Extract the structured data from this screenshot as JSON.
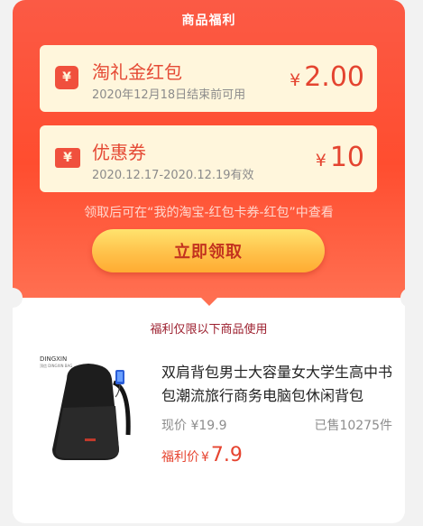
{
  "header": {
    "title": "商品福利"
  },
  "coupons": [
    {
      "name": "淘礼金红包",
      "sub": "2020年12月18日结束前可用",
      "currency": "¥",
      "amount": "2.00",
      "icon": "red-envelope-icon"
    },
    {
      "name": "优惠券",
      "sub": "2020.12.17-2020.12.19有效",
      "currency": "¥",
      "amount": "10",
      "icon": "coupon-ticket-icon"
    }
  ],
  "note": "领取后可在“我的淘宝-红包卡券-红包”中查看",
  "claim_button": "立即领取",
  "product_section": {
    "title": "福利仅限以下商品使用"
  },
  "product": {
    "brand": "DINGXIN",
    "brand_sub": "顶信 DINGXIN BAG",
    "title": "双肩背包男士大容量女大学生高中书包潮流旅行商务电脑包休闲背包",
    "price_label": "现价",
    "price_currency": "¥",
    "price": "19.9",
    "sold": "已售10275件",
    "welfare_label": "福利价",
    "welfare_currency": "¥",
    "welfare_price": "7.9"
  },
  "colors": {
    "accent": "#ff4d2f",
    "coupon_bg": "#fff6dc",
    "button": "#ffc14a"
  }
}
